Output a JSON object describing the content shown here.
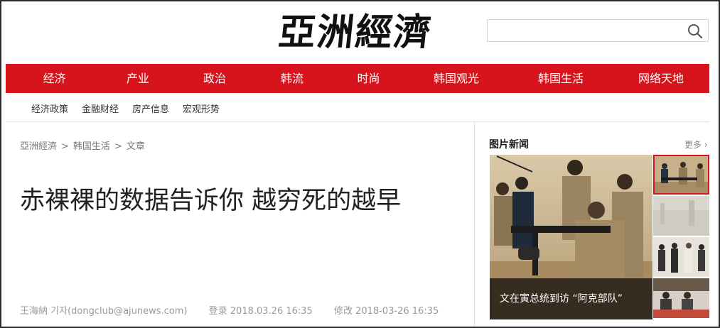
{
  "logo": {
    "text": "亞洲經濟"
  },
  "search": {
    "placeholder": "",
    "value": ""
  },
  "nav": {
    "items": [
      "经济",
      "产业",
      "政治",
      "韩流",
      "时尚",
      "韩国观光",
      "韩国生活",
      "网络天地"
    ]
  },
  "subnav": {
    "items": [
      "经济政策",
      "金融财经",
      "房产信息",
      "宏观形势"
    ]
  },
  "breadcrumb": {
    "home": "亞洲經濟",
    "section": "韩国生活",
    "current": "文章",
    "separator": ">"
  },
  "article": {
    "title": "赤裸裸的数据告诉你 越穷死的越早",
    "author": "王海納 기자(dongclub@ajunews.com)",
    "registered": "登录 2018.03.26 16:35",
    "modified": "修改 2018-03-26 16:35"
  },
  "sidebar": {
    "title": "图片新闻",
    "more": "更多 ›",
    "main_caption": "文在寅总统到访 “阿克部队”"
  },
  "colors": {
    "brand_red": "#d7141c",
    "caption_overlay": "rgba(0,0,0,0.68)"
  },
  "icons": {
    "search": "search-icon"
  }
}
